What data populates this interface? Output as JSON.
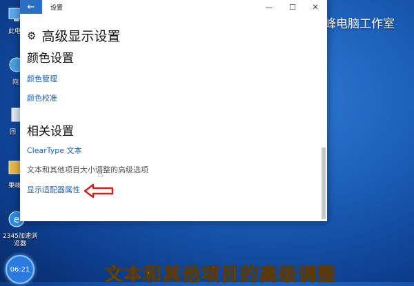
{
  "desktop": {
    "icons": [
      "此电",
      "网",
      "回",
      "果峰",
      "2345加速浏览器"
    ],
    "watermark": "峰电脑工作室",
    "subtitle": "文本和其他项目的高级调整",
    "clock": "06:21"
  },
  "window": {
    "title": "设置",
    "back_glyph": "←",
    "controls": {
      "minimize": "—",
      "maximize": "☐",
      "close": "✕"
    }
  },
  "page": {
    "title": "高级显示设置",
    "color_section": {
      "header": "颜色设置",
      "links": [
        "颜色管理",
        "颜色校准"
      ]
    },
    "related_section": {
      "header": "相关设置",
      "cleartype": "ClearType 文本",
      "advanced": "文本和其他项目大小调整的高级选项",
      "adapter": "显示适配器属性"
    }
  },
  "annotation": {
    "arrow_color": "#d81e1e"
  },
  "colors": {
    "accent": "#2b6fc2",
    "link": "#1a63b8"
  }
}
